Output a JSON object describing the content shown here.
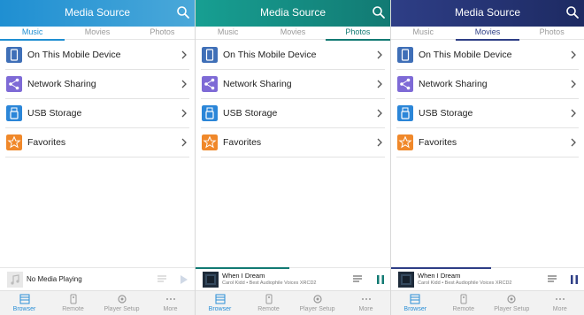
{
  "colors": {
    "header_p0_start": "#1f8fd2",
    "header_p0_end": "#4aa8d9",
    "header_p1_start": "#179f92",
    "header_p1_end": "#127a73",
    "header_p2_start": "#2e3e86",
    "header_p2_end": "#1d2a62",
    "tab_active_p0": "#1f8fd2",
    "tab_active_p1": "#127a73",
    "tab_active_p2": "#2e3e86",
    "icon_device": "#3f6fb7",
    "icon_network": "#7e6ad6",
    "icon_usb": "#2b86d8",
    "icon_favorites": "#f0882a",
    "progress_p1": "#127a73",
    "progress_p2": "#2e3e86",
    "pause_p1": "#127a73",
    "pause_p2": "#2e3e86"
  },
  "panels": [
    {
      "title": "Media Source",
      "tabs": [
        "Music",
        "Movies",
        "Photos"
      ],
      "active_tab": "Music",
      "sources": [
        {
          "label": "On This Mobile Device",
          "icon": "mobile-device-icon"
        },
        {
          "label": "Network Sharing",
          "icon": "share-icon"
        },
        {
          "label": "USB Storage",
          "icon": "usb-icon"
        },
        {
          "label": "Favorites",
          "icon": "star-icon"
        }
      ],
      "now_playing": {
        "text": "No Media Playing"
      },
      "nav": [
        "Browser",
        "Remote",
        "Player Setup",
        "More"
      ]
    },
    {
      "title": "Media Source",
      "tabs": [
        "Music",
        "Movies",
        "Photos"
      ],
      "active_tab": "Photos",
      "sources": [
        {
          "label": "On This Mobile Device",
          "icon": "mobile-device-icon"
        },
        {
          "label": "Network Sharing",
          "icon": "share-icon"
        },
        {
          "label": "USB Storage",
          "icon": "usb-icon"
        },
        {
          "label": "Favorites",
          "icon": "star-icon"
        }
      ],
      "now_playing": {
        "song": "When I Dream",
        "artist_album": "Carol Kidd • Best Audiophile Voices XRCD2",
        "progress": 0.48
      },
      "nav": [
        "Browser",
        "Remote",
        "Player Setup",
        "More"
      ]
    },
    {
      "title": "Media Source",
      "tabs": [
        "Music",
        "Movies",
        "Photos"
      ],
      "active_tab": "Movies",
      "sources": [
        {
          "label": "On This Mobile Device",
          "icon": "mobile-device-icon"
        },
        {
          "label": "Network Sharing",
          "icon": "share-icon"
        },
        {
          "label": "USB Storage",
          "icon": "usb-icon"
        },
        {
          "label": "Favorites",
          "icon": "star-icon"
        }
      ],
      "now_playing": {
        "song": "When I Dream",
        "artist_album": "Carol Kidd • Best Audiophile Voices XRCD2",
        "progress": 0.52
      },
      "nav": [
        "Browser",
        "Remote",
        "Player Setup",
        "More"
      ]
    }
  ]
}
